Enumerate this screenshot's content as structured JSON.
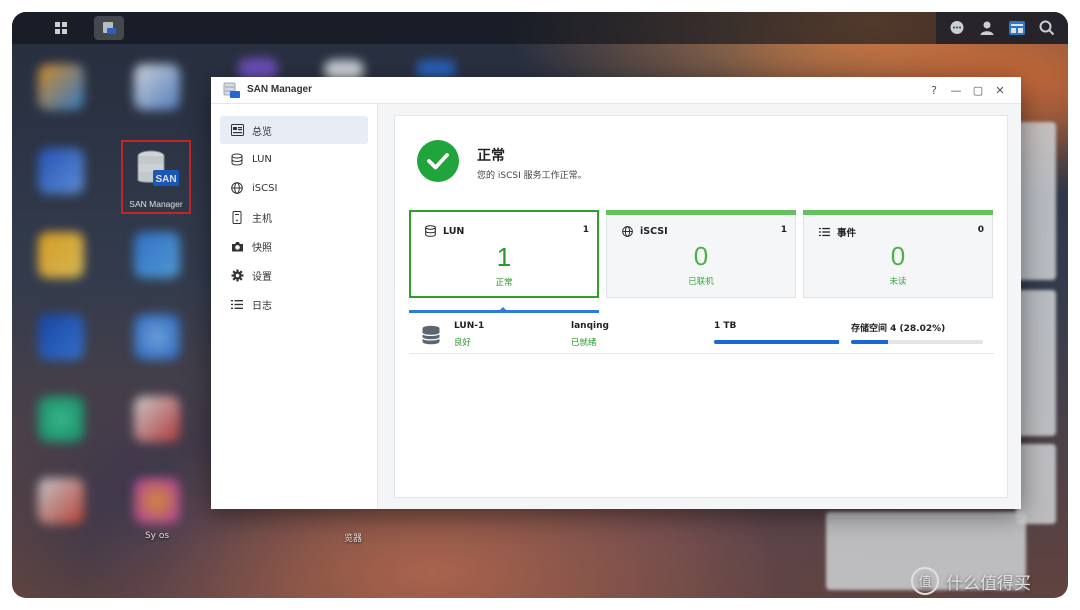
{
  "colors": {
    "accent_green": "#20a43c",
    "selected_border": "#2ea12b",
    "bar_blue": "#1a68d6",
    "highlight_red": "#e02a2a"
  },
  "desktop": {
    "san_icon_label": "SAN Manager",
    "partial_labels": {
      "synology_photos": "Sy          os",
      "browser": "览器"
    }
  },
  "taskbar": {
    "icons": [
      "main-menu-icon",
      "san-manager-icon",
      "chat-icon",
      "user-icon",
      "widgets-icon",
      "search-icon"
    ]
  },
  "window": {
    "title": "SAN Manager",
    "controls": {
      "help": "?",
      "minimize": "—",
      "maximize": "▢",
      "close": "✕"
    },
    "sidebar": [
      {
        "label": "总览",
        "icon": "overview-icon",
        "active": true
      },
      {
        "label": "LUN",
        "icon": "lun-icon",
        "active": false
      },
      {
        "label": "iSCSI",
        "icon": "globe-icon",
        "active": false
      },
      {
        "label": "主机",
        "icon": "host-icon",
        "active": false
      },
      {
        "label": "快照",
        "icon": "camera-icon",
        "active": false
      },
      {
        "label": "设置",
        "icon": "gear-icon",
        "active": false
      },
      {
        "label": "日志",
        "icon": "log-icon",
        "active": false
      }
    ],
    "status": {
      "title": "正常",
      "description": "您的 iSCSI 服务工作正常。"
    },
    "cards": [
      {
        "title": "LUN",
        "count": "1",
        "value": "1",
        "sub": "正常",
        "icon": "lun-icon",
        "selected": true
      },
      {
        "title": "iSCSI",
        "count": "1",
        "value": "0",
        "sub": "已联机",
        "icon": "globe-icon",
        "selected": false
      },
      {
        "title": "事件",
        "count": "0",
        "value": "0",
        "sub": "未读",
        "icon": "list-icon",
        "selected": false
      }
    ],
    "lun_row": {
      "name": "LUN-1",
      "health": "良好",
      "target": "lanqing",
      "target_status": "已就绪",
      "capacity": "1 TB",
      "capacity_usage_fraction": 0.99,
      "pool": "存储空间 4 (28.02%)",
      "pool_usage_fraction": 0.2802
    }
  },
  "watermark": {
    "text": "什么值得买",
    "logo_char": "值"
  }
}
